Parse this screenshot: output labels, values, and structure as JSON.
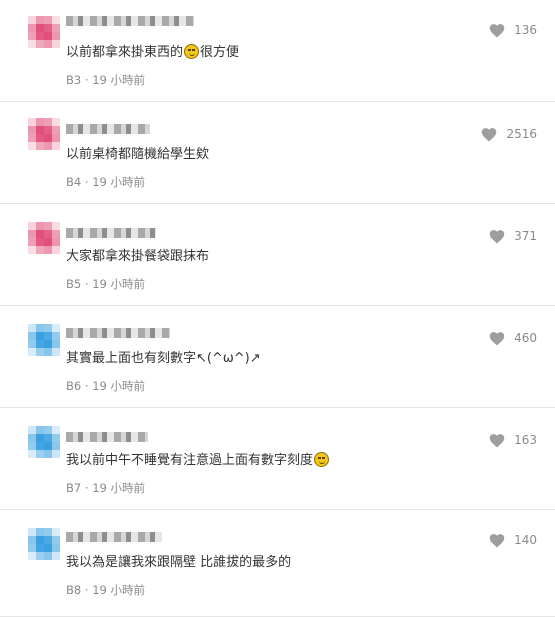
{
  "comments": [
    {
      "floor": "B3",
      "time": "19 小時前",
      "text_before": "以前都拿來掛東西的",
      "emoji": "laughing-face",
      "text_after": "很方便",
      "likes": "136",
      "avatar_color": "#e0507a"
    },
    {
      "floor": "B4",
      "time": "19 小時前",
      "text_before": "以前桌椅都隨機給學生欸",
      "emoji": "",
      "text_after": "",
      "likes": "2516",
      "avatar_color": "#e0507a"
    },
    {
      "floor": "B5",
      "time": "19 小時前",
      "text_before": "大家都拿來掛餐袋跟抹布",
      "emoji": "",
      "text_after": "",
      "likes": "371",
      "avatar_color": "#e0507a"
    },
    {
      "floor": "B6",
      "time": "19 小時前",
      "text_before": "其實最上面也有刻數字↖(^ω^)↗",
      "emoji": "",
      "text_after": "",
      "likes": "460",
      "avatar_color": "#3aa0e0"
    },
    {
      "floor": "B7",
      "time": "19 小時前",
      "text_before": "我以前中午不睡覺有注意過上面有數字刻度",
      "emoji": "laughing-face",
      "text_after": "",
      "likes": "163",
      "avatar_color": "#3aa0e0"
    },
    {
      "floor": "B8",
      "time": "19 小時前",
      "text_before": "我以為是讓我來跟隔壁 比誰拔的最多的",
      "emoji": "",
      "text_after": "",
      "likes": "140",
      "avatar_color": "#3aa0e0"
    }
  ],
  "meta_separator": "·",
  "heart_icon": "heart-icon",
  "colors": {
    "text": "#333333",
    "meta": "#8a8a8a",
    "heart": "#9e9e9e",
    "divider": "#e6e6e6"
  }
}
